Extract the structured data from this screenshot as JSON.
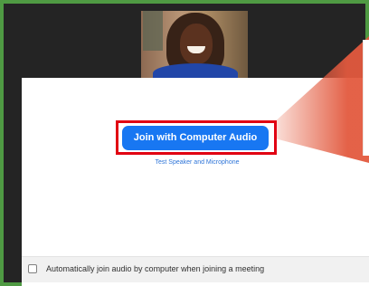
{
  "audio_prompt": {
    "join_button_label": "Join with Computer Audio",
    "test_link_label": "Test Speaker and Microphone",
    "auto_join_label": "Automatically join audio by computer when joining a meeting",
    "auto_join_checked": false
  },
  "icons": {
    "checkbox": "checkbox-icon"
  },
  "colors": {
    "frame_border": "#4f9a43",
    "primary_button": "#1877f2",
    "link": "#2d74d8",
    "highlight": "#e10012",
    "callout": "#e2593e"
  }
}
